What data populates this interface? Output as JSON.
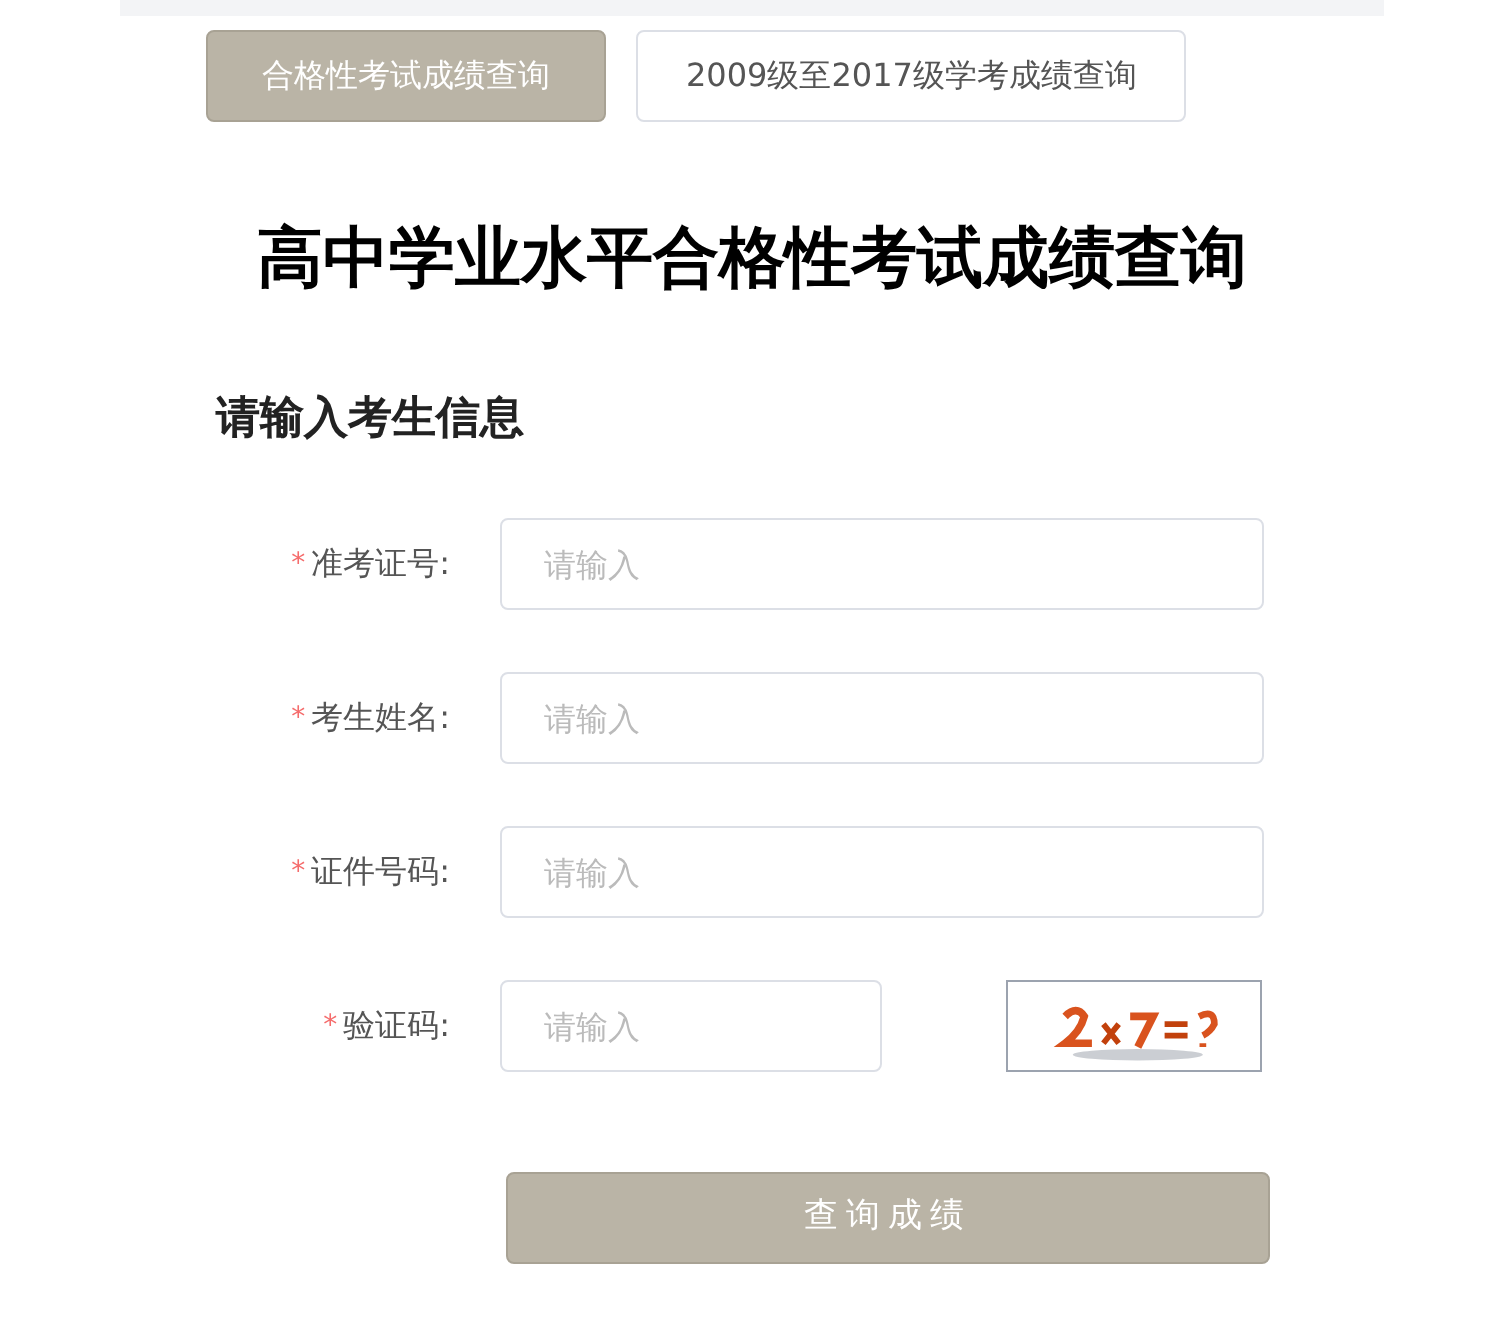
{
  "tabs": [
    {
      "label": "合格性考试成绩查询",
      "selected": true
    },
    {
      "label": "2009级至2017级学考成绩查询",
      "selected": false
    }
  ],
  "title": "高中学业水平合格性考试成绩查询",
  "section_title": "请输入考生信息",
  "fields": [
    {
      "kind": "text",
      "label": "准考证号:",
      "required_mark": "*",
      "placeholder": "请输入"
    },
    {
      "kind": "text",
      "label": "考生姓名:",
      "required_mark": "*",
      "placeholder": "请输入"
    },
    {
      "kind": "text",
      "label": "证件号码:",
      "required_mark": "*",
      "placeholder": "请输入"
    },
    {
      "kind": "captcha",
      "label": "验证码:",
      "required_mark": "*",
      "placeholder": "请输入"
    }
  ],
  "submit": "查询成绩"
}
